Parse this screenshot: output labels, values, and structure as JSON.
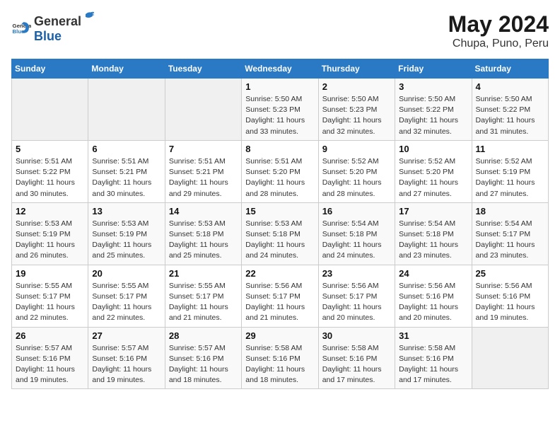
{
  "header": {
    "logo_general": "General",
    "logo_blue": "Blue",
    "title": "May 2024",
    "subtitle": "Chupa, Puno, Peru"
  },
  "weekdays": [
    "Sunday",
    "Monday",
    "Tuesday",
    "Wednesday",
    "Thursday",
    "Friday",
    "Saturday"
  ],
  "weeks": [
    [
      {
        "day": "",
        "info": ""
      },
      {
        "day": "",
        "info": ""
      },
      {
        "day": "",
        "info": ""
      },
      {
        "day": "1",
        "info": "Sunrise: 5:50 AM\nSunset: 5:23 PM\nDaylight: 11 hours\nand 33 minutes."
      },
      {
        "day": "2",
        "info": "Sunrise: 5:50 AM\nSunset: 5:23 PM\nDaylight: 11 hours\nand 32 minutes."
      },
      {
        "day": "3",
        "info": "Sunrise: 5:50 AM\nSunset: 5:22 PM\nDaylight: 11 hours\nand 32 minutes."
      },
      {
        "day": "4",
        "info": "Sunrise: 5:50 AM\nSunset: 5:22 PM\nDaylight: 11 hours\nand 31 minutes."
      }
    ],
    [
      {
        "day": "5",
        "info": "Sunrise: 5:51 AM\nSunset: 5:22 PM\nDaylight: 11 hours\nand 30 minutes."
      },
      {
        "day": "6",
        "info": "Sunrise: 5:51 AM\nSunset: 5:21 PM\nDaylight: 11 hours\nand 30 minutes."
      },
      {
        "day": "7",
        "info": "Sunrise: 5:51 AM\nSunset: 5:21 PM\nDaylight: 11 hours\nand 29 minutes."
      },
      {
        "day": "8",
        "info": "Sunrise: 5:51 AM\nSunset: 5:20 PM\nDaylight: 11 hours\nand 28 minutes."
      },
      {
        "day": "9",
        "info": "Sunrise: 5:52 AM\nSunset: 5:20 PM\nDaylight: 11 hours\nand 28 minutes."
      },
      {
        "day": "10",
        "info": "Sunrise: 5:52 AM\nSunset: 5:20 PM\nDaylight: 11 hours\nand 27 minutes."
      },
      {
        "day": "11",
        "info": "Sunrise: 5:52 AM\nSunset: 5:19 PM\nDaylight: 11 hours\nand 27 minutes."
      }
    ],
    [
      {
        "day": "12",
        "info": "Sunrise: 5:53 AM\nSunset: 5:19 PM\nDaylight: 11 hours\nand 26 minutes."
      },
      {
        "day": "13",
        "info": "Sunrise: 5:53 AM\nSunset: 5:19 PM\nDaylight: 11 hours\nand 25 minutes."
      },
      {
        "day": "14",
        "info": "Sunrise: 5:53 AM\nSunset: 5:18 PM\nDaylight: 11 hours\nand 25 minutes."
      },
      {
        "day": "15",
        "info": "Sunrise: 5:53 AM\nSunset: 5:18 PM\nDaylight: 11 hours\nand 24 minutes."
      },
      {
        "day": "16",
        "info": "Sunrise: 5:54 AM\nSunset: 5:18 PM\nDaylight: 11 hours\nand 24 minutes."
      },
      {
        "day": "17",
        "info": "Sunrise: 5:54 AM\nSunset: 5:18 PM\nDaylight: 11 hours\nand 23 minutes."
      },
      {
        "day": "18",
        "info": "Sunrise: 5:54 AM\nSunset: 5:17 PM\nDaylight: 11 hours\nand 23 minutes."
      }
    ],
    [
      {
        "day": "19",
        "info": "Sunrise: 5:55 AM\nSunset: 5:17 PM\nDaylight: 11 hours\nand 22 minutes."
      },
      {
        "day": "20",
        "info": "Sunrise: 5:55 AM\nSunset: 5:17 PM\nDaylight: 11 hours\nand 22 minutes."
      },
      {
        "day": "21",
        "info": "Sunrise: 5:55 AM\nSunset: 5:17 PM\nDaylight: 11 hours\nand 21 minutes."
      },
      {
        "day": "22",
        "info": "Sunrise: 5:56 AM\nSunset: 5:17 PM\nDaylight: 11 hours\nand 21 minutes."
      },
      {
        "day": "23",
        "info": "Sunrise: 5:56 AM\nSunset: 5:17 PM\nDaylight: 11 hours\nand 20 minutes."
      },
      {
        "day": "24",
        "info": "Sunrise: 5:56 AM\nSunset: 5:16 PM\nDaylight: 11 hours\nand 20 minutes."
      },
      {
        "day": "25",
        "info": "Sunrise: 5:56 AM\nSunset: 5:16 PM\nDaylight: 11 hours\nand 19 minutes."
      }
    ],
    [
      {
        "day": "26",
        "info": "Sunrise: 5:57 AM\nSunset: 5:16 PM\nDaylight: 11 hours\nand 19 minutes."
      },
      {
        "day": "27",
        "info": "Sunrise: 5:57 AM\nSunset: 5:16 PM\nDaylight: 11 hours\nand 19 minutes."
      },
      {
        "day": "28",
        "info": "Sunrise: 5:57 AM\nSunset: 5:16 PM\nDaylight: 11 hours\nand 18 minutes."
      },
      {
        "day": "29",
        "info": "Sunrise: 5:58 AM\nSunset: 5:16 PM\nDaylight: 11 hours\nand 18 minutes."
      },
      {
        "day": "30",
        "info": "Sunrise: 5:58 AM\nSunset: 5:16 PM\nDaylight: 11 hours\nand 17 minutes."
      },
      {
        "day": "31",
        "info": "Sunrise: 5:58 AM\nSunset: 5:16 PM\nDaylight: 11 hours\nand 17 minutes."
      },
      {
        "day": "",
        "info": ""
      }
    ]
  ]
}
